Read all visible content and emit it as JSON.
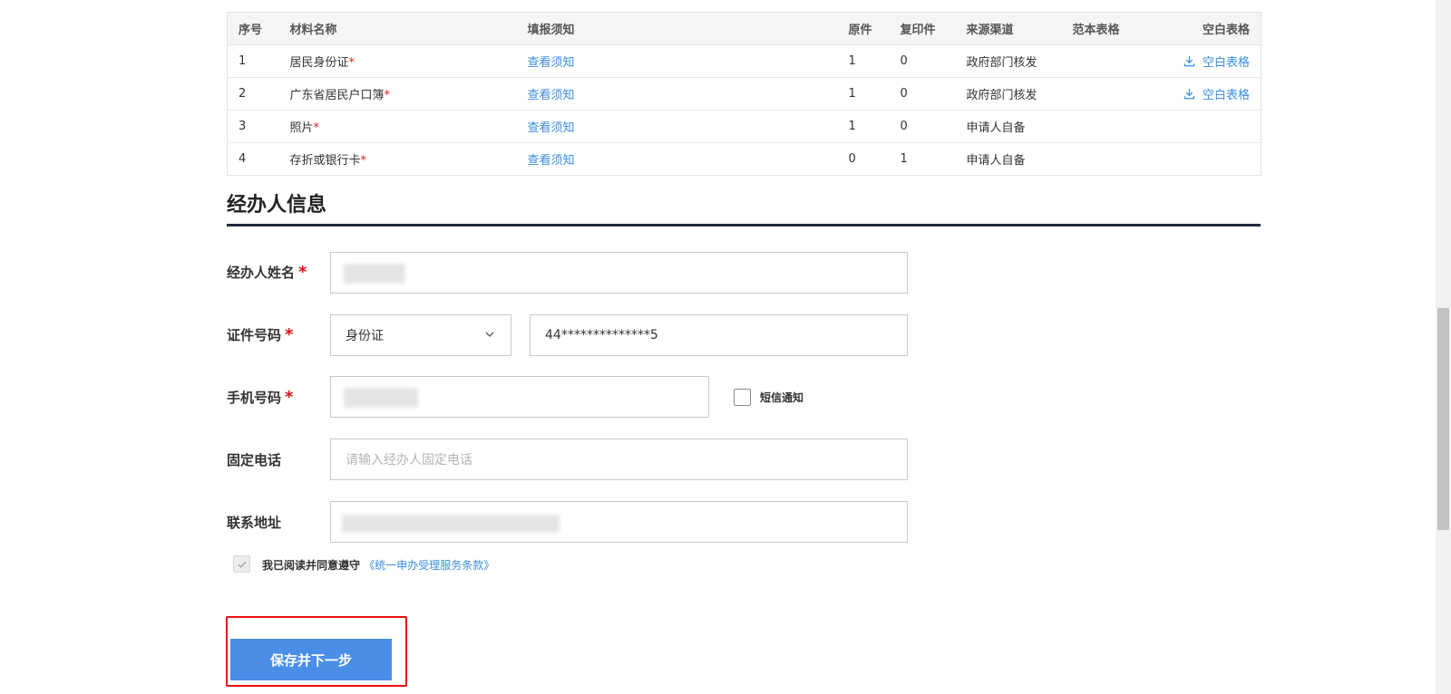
{
  "materials_table": {
    "headers": [
      "序号",
      "材料名称",
      "填报须知",
      "原件",
      "复印件",
      "来源渠道",
      "范本表格",
      "空白表格"
    ],
    "rows": [
      {
        "no": "1",
        "name": "居民身份证",
        "required_mark": "*",
        "notice": "查看须知",
        "original": "1",
        "copy": "0",
        "source": "政府部门核发",
        "sample": "",
        "blank": "空白表格"
      },
      {
        "no": "2",
        "name": "广东省居民户口簿",
        "required_mark": "*",
        "notice": "查看须知",
        "original": "1",
        "copy": "0",
        "source": "政府部门核发",
        "sample": "",
        "blank": "空白表格"
      },
      {
        "no": "3",
        "name": "照片",
        "required_mark": "*",
        "notice": "查看须知",
        "original": "1",
        "copy": "0",
        "source": "申请人自备",
        "sample": "",
        "blank": ""
      },
      {
        "no": "4",
        "name": "存折或银行卡",
        "required_mark": "*",
        "notice": "查看须知",
        "original": "0",
        "copy": "1",
        "source": "申请人自备",
        "sample": "",
        "blank": ""
      }
    ]
  },
  "section": {
    "title": "经办人信息"
  },
  "form": {
    "required_mark": "*",
    "name_label": "经办人姓名",
    "id_label": "证件号码",
    "id_type_value": "身份证",
    "id_number_value": "44**************5",
    "phone_label": "手机号码",
    "sms_label": "短信通知",
    "landline_label": "固定电话",
    "landline_placeholder": "请输入经办人固定电话",
    "address_label": "联系地址"
  },
  "agreement": {
    "text": "我已阅读并同意遵守",
    "link": "《统一申办受理服务条款》",
    "checked": true
  },
  "submit_button": "保存并下一步",
  "colors": {
    "link": "#3b8ee0",
    "required": "#d8141b",
    "primary_button": "#4a8ee8",
    "highlight_border": "#ee1111",
    "section_rule": "#1f2d3d"
  }
}
